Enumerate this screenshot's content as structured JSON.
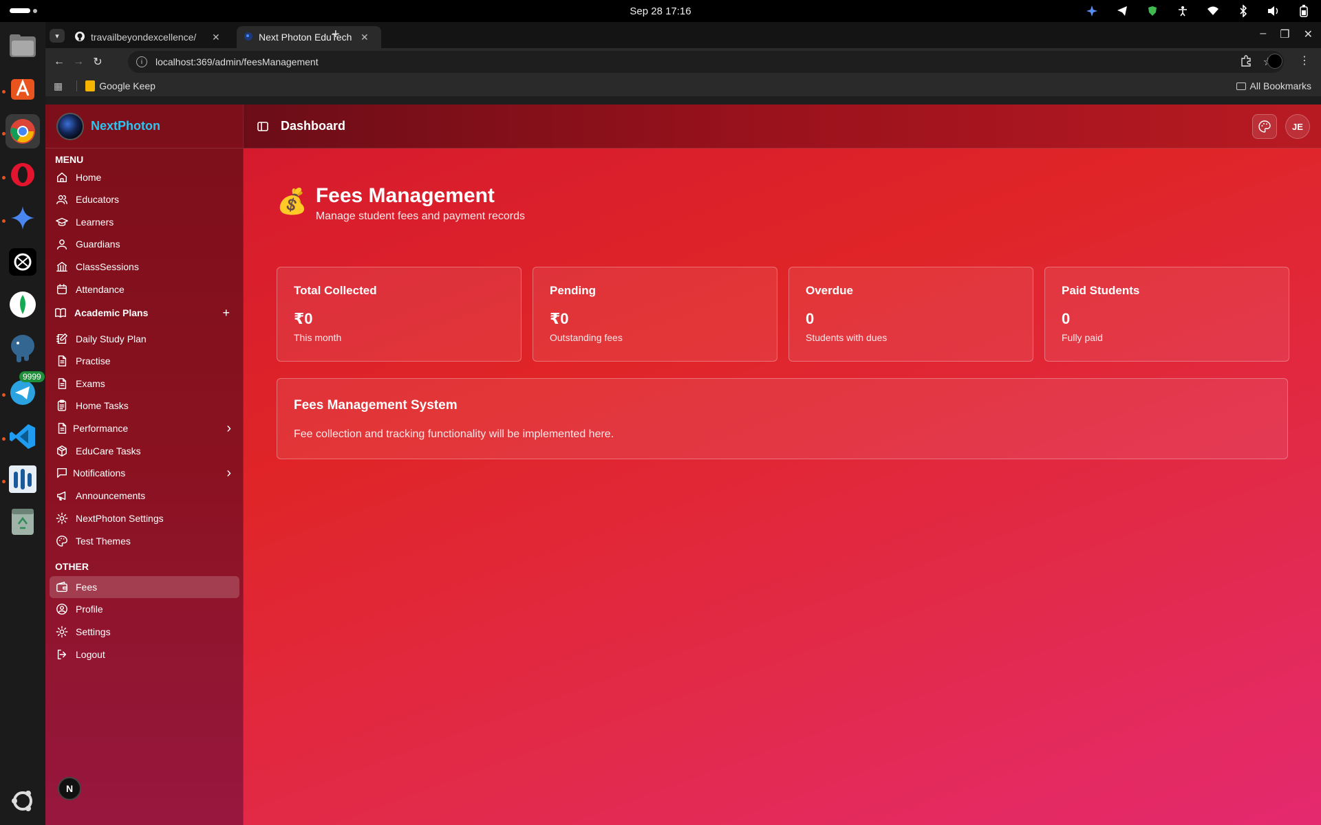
{
  "system": {
    "datetime": "Sep 28  17:16",
    "telegram_badge": "9999"
  },
  "browser": {
    "tabs": [
      {
        "title": "travailbeyondexcellence/",
        "icon": "github-icon"
      },
      {
        "title": "Next Photon EduTech Ma",
        "icon": "nextphoton-icon"
      }
    ],
    "url": "localhost:369/admin/feesManagement",
    "bookmarks": [
      {
        "label": "Google Keep"
      }
    ],
    "all_bookmarks": "All Bookmarks"
  },
  "sidebar": {
    "brand": "NextPhoton",
    "menu_label": "MENU",
    "other_label": "OTHER",
    "menu_items": [
      {
        "label": "Home",
        "icon": "home-icon"
      },
      {
        "label": "Educators",
        "icon": "users-icon"
      },
      {
        "label": "Learners",
        "icon": "graduation-cap-icon"
      },
      {
        "label": "Guardians",
        "icon": "user-icon"
      },
      {
        "label": "ClassSessions",
        "icon": "building-icon"
      },
      {
        "label": "Attendance",
        "icon": "calendar-icon"
      },
      {
        "label": "Academic Plans",
        "icon": "book-icon"
      },
      {
        "label": "Daily Study Plan",
        "icon": "notebook-pen-icon"
      },
      {
        "label": "Practise",
        "icon": "file-text-icon"
      },
      {
        "label": "Exams",
        "icon": "file-text-icon"
      },
      {
        "label": "Home Tasks",
        "icon": "clipboard-icon"
      },
      {
        "label": "Performance",
        "icon": "file-text-icon"
      },
      {
        "label": "EduCare Tasks",
        "icon": "package-icon"
      },
      {
        "label": "Notifications",
        "icon": "message-square-icon"
      },
      {
        "label": "Announcements",
        "icon": "megaphone-icon"
      },
      {
        "label": "NextPhoton Settings",
        "icon": "gear-icon"
      },
      {
        "label": "Test Themes",
        "icon": "palette-icon"
      }
    ],
    "other_items": [
      {
        "label": "Fees",
        "icon": "wallet-icon"
      },
      {
        "label": "Profile",
        "icon": "user-circle-icon"
      },
      {
        "label": "Settings",
        "icon": "gear-icon"
      },
      {
        "label": "Logout",
        "icon": "logout-icon"
      }
    ],
    "user_initial": "N"
  },
  "header": {
    "title": "Dashboard",
    "avatar": "JE"
  },
  "main": {
    "title": "Fees Management",
    "subtitle": "Manage student fees and payment records",
    "emoji": "💰",
    "cards": [
      {
        "label": "Total Collected",
        "value": "₹0",
        "sub": "This month"
      },
      {
        "label": "Pending",
        "value": "₹0",
        "sub": "Outstanding fees"
      },
      {
        "label": "Overdue",
        "value": "0",
        "sub": "Students with dues"
      },
      {
        "label": "Paid Students",
        "value": "0",
        "sub": "Fully paid"
      }
    ],
    "panel": {
      "title": "Fees Management System",
      "description": "Fee collection and tracking functionality will be implemented here."
    }
  }
}
